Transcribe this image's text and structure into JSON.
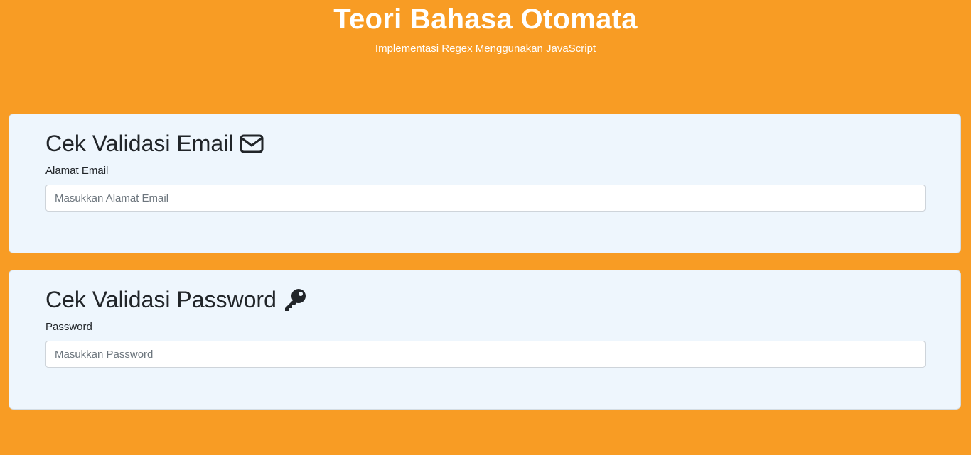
{
  "header": {
    "title": "Teori Bahasa Otomata",
    "subtitle": "Implementasi Regex Menggunakan JavaScript"
  },
  "email_card": {
    "title": "Cek Validasi Email",
    "icon": "envelope-icon",
    "label": "Alamat Email",
    "value": "",
    "placeholder": "Masukkan Alamat Email"
  },
  "password_card": {
    "title": "Cek Validasi Password",
    "icon": "key-icon",
    "label": "Password",
    "value": "",
    "placeholder": "Masukkan Password"
  },
  "colors": {
    "background": "#f89c24",
    "card_background": "#eef6fd",
    "header_text": "#ffffff",
    "text": "#212529"
  }
}
